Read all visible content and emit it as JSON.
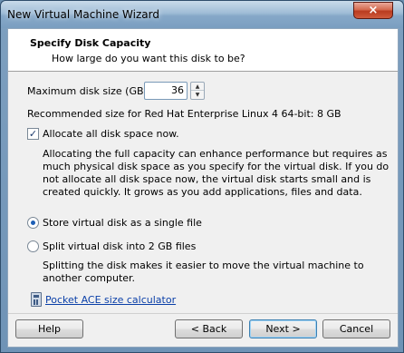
{
  "window": {
    "title": "New Virtual Machine Wizard",
    "close_label": "×"
  },
  "header": {
    "title": "Specify Disk Capacity",
    "subtitle": "How large do you want this disk to be?"
  },
  "disk": {
    "max_size_label": "Maximum disk size (GB):",
    "max_size_value": "36",
    "recommended": "Recommended size for Red Hat Enterprise Linux 4 64-bit: 8 GB"
  },
  "allocate": {
    "label": "Allocate all disk space now.",
    "checked": true,
    "description": "Allocating the full capacity can enhance performance but requires as much physical disk space as you specify for the virtual disk. If you do not allocate all disk space now, the virtual disk starts small and is created quickly. It grows as you add applications, files and data."
  },
  "storage_options": [
    {
      "label": "Store virtual disk as a single file",
      "selected": true
    },
    {
      "label": "Split virtual disk into 2 GB files",
      "selected": false
    }
  ],
  "split_description": "Splitting the disk makes it easier to move the virtual machine to another computer.",
  "calculator_link": "Pocket ACE size calculator",
  "buttons": {
    "help": "Help",
    "back": "< Back",
    "next": "Next >",
    "cancel": "Cancel"
  }
}
